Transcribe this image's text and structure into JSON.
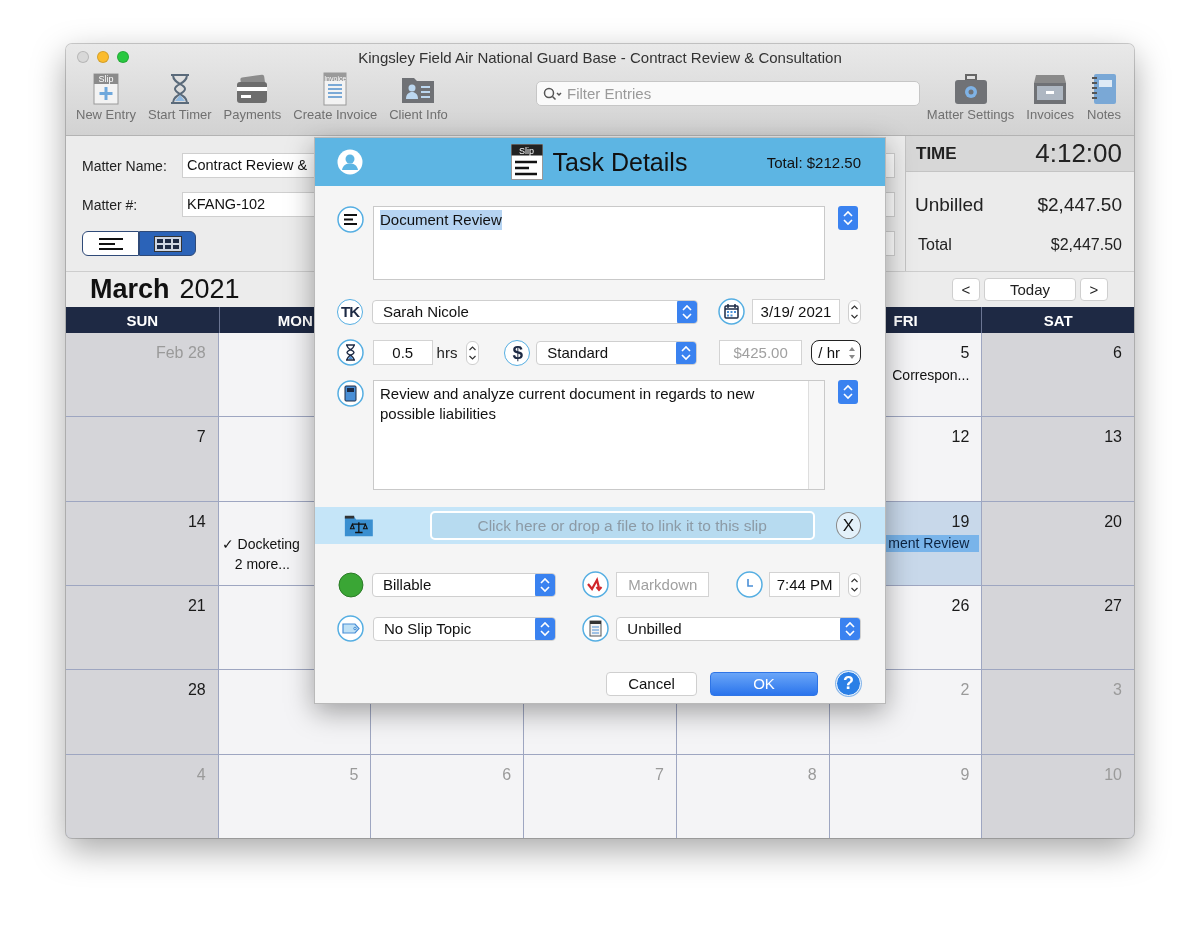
{
  "window": {
    "title": "Kingsley Field Air National Guard Base - Contract Review & Consultation"
  },
  "toolbar": {
    "left": [
      {
        "label": "New Entry",
        "badge": "Slip"
      },
      {
        "label": "Start Timer"
      },
      {
        "label": "Payments"
      },
      {
        "label": "Create Invoice",
        "badge": "Invoice"
      },
      {
        "label": "Client Info"
      }
    ],
    "right": [
      {
        "label": "Matter Settings"
      },
      {
        "label": "Invoices"
      },
      {
        "label": "Notes"
      }
    ]
  },
  "search": {
    "placeholder": "Filter Entries"
  },
  "matter": {
    "fields": [
      {
        "label": "Matter Name:",
        "value": "Contract Review &"
      },
      {
        "label": "Matter #:",
        "value": "KFANG-102"
      }
    ],
    "view_modes": [
      {
        "selected": false
      },
      {
        "selected": true
      }
    ]
  },
  "summary": {
    "time_label": "TIME",
    "time": "4:12:00",
    "rows": [
      {
        "label": "Unbilled",
        "value": "$2,447.50"
      },
      {
        "label": "Total",
        "value": "$2,447.50"
      }
    ]
  },
  "calendar": {
    "month": "March",
    "year": "2021",
    "nav": [
      "<",
      "Today",
      ">"
    ],
    "weekdays": {
      "left": [
        "SUN",
        "MON"
      ],
      "right": [
        "FRI",
        "SAT"
      ]
    },
    "weeks": [
      {
        "left": [
          {
            "day": "Feb 28",
            "other_month": true,
            "selected": false
          },
          {
            "selected": false
          }
        ],
        "right": [
          {
            "day": "5",
            "other_month": false,
            "selected": false,
            "events": [
              {
                "kind": "item",
                "text": "Correspon..."
              }
            ]
          },
          {
            "day": "6",
            "other_month": false,
            "selected": false
          }
        ]
      },
      {
        "left": [
          {
            "day": "7",
            "other_month": false,
            "selected": false
          },
          {
            "selected": false
          }
        ],
        "right": [
          {
            "day": "12",
            "other_month": false,
            "selected": false
          },
          {
            "day": "13",
            "other_month": false,
            "selected": false
          }
        ]
      },
      {
        "left": [
          {
            "day": "14",
            "other_month": false,
            "selected": false
          },
          {
            "selected": false,
            "events": [
              {
                "kind": "item",
                "text": "✓ Docketing"
              },
              {
                "kind": "more",
                "text": "2 more..."
              }
            ]
          }
        ],
        "right": [
          {
            "day": "19",
            "other_month": false,
            "selected": true,
            "events": [
              {
                "kind": "bar",
                "text": "ment Review"
              }
            ]
          },
          {
            "day": "20",
            "other_month": false,
            "selected": false
          }
        ]
      },
      {
        "left": [
          {
            "day": "21",
            "other_month": false,
            "selected": false
          },
          {
            "selected": false
          }
        ],
        "right": [
          {
            "day": "26",
            "other_month": false,
            "selected": false
          },
          {
            "day": "27",
            "other_month": false,
            "selected": false
          }
        ]
      },
      {
        "left": [
          {
            "day": "28",
            "other_month": false,
            "selected": false
          },
          {
            "selected": false
          }
        ],
        "right": [
          {
            "day": "2",
            "other_month": true,
            "selected": false
          },
          {
            "day": "3",
            "other_month": true,
            "selected": false
          }
        ]
      },
      {
        "cells": [
          {
            "day": "4",
            "other_month": true,
            "selected": false
          },
          {
            "day": "5",
            "other_month": true,
            "selected": false
          },
          {
            "day": "6",
            "other_month": true,
            "selected": false
          },
          {
            "day": "7",
            "other_month": true,
            "selected": false
          },
          {
            "day": "8",
            "other_month": true,
            "selected": false
          },
          {
            "day": "9",
            "other_month": true,
            "selected": false
          },
          {
            "day": "10",
            "other_month": true,
            "selected": false
          }
        ]
      }
    ]
  },
  "dialog": {
    "slip_badge": "Slip",
    "title": "Task Details",
    "total": "Total: $212.50",
    "description": {
      "value": "Document Review",
      "selected": true
    },
    "timekeeper": {
      "badge": "TK",
      "value": "Sarah Nicole"
    },
    "date": "3/19/ 2021",
    "hours": "0.5",
    "hours_unit": "hrs",
    "rate_type": {
      "badge": "$",
      "value": "Standard"
    },
    "rate": {
      "value": "$425.00",
      "disabled": true
    },
    "rate_unit": "/ hr",
    "notes": "Review and analyze current document in regards to new possible liabilities",
    "link_field": {
      "placeholder": "Click here or drop a file to link it to this slip"
    },
    "clear_button": "X",
    "billing_status": "Billable",
    "markdown": {
      "placeholder": "Markdown"
    },
    "time": "7:44 PM",
    "topic": "No Slip Topic",
    "invoice_status": "Unbilled",
    "buttons": [
      {
        "label": "Cancel",
        "kind": "secondary"
      },
      {
        "label": "OK",
        "kind": "primary"
      }
    ],
    "help": "?"
  }
}
